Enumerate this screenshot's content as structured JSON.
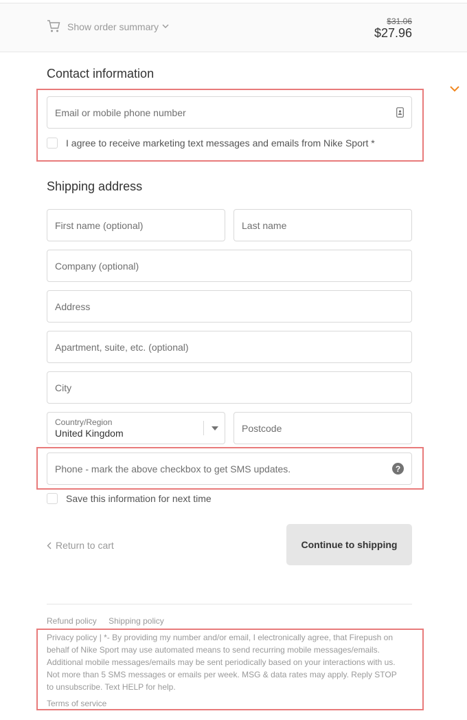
{
  "header": {
    "summary_toggle": "Show order summary",
    "original_price": "$31.06",
    "total_price": "$27.96"
  },
  "contact": {
    "title": "Contact information",
    "email_placeholder": "Email or mobile phone number",
    "marketing_label": "I agree to receive marketing text messages and emails from Nike Sport *",
    "marketing_checked": false
  },
  "shipping": {
    "title": "Shipping address",
    "first_name_placeholder": "First name (optional)",
    "last_name_placeholder": "Last name",
    "company_placeholder": "Company (optional)",
    "address_placeholder": "Address",
    "apartment_placeholder": "Apartment, suite, etc. (optional)",
    "city_placeholder": "City",
    "country_label": "Country/Region",
    "country_value": "United Kingdom",
    "postcode_placeholder": "Postcode",
    "phone_placeholder": "Phone - mark the above checkbox to get SMS updates.",
    "save_info_label": "Save this information for next time",
    "save_info_checked": false
  },
  "actions": {
    "return_label": "Return to cart",
    "continue_label": "Continue to shipping"
  },
  "footer": {
    "refund_policy": "Refund policy",
    "shipping_policy": "Shipping policy",
    "privacy_text": "Privacy policy | *- By providing my number and/or email, I electronically agree, that Firepush on behalf of Nike Sport may use automated means to send recurring mobile messages/emails. Additional mobile messages/emails may be sent periodically based on your interactions with us. Not more than 5 SMS messages or emails per week. MSG & data rates may apply. Reply STOP to unsubscribe. Text HELP for help.",
    "terms_of_service": "Terms of service"
  },
  "icons": {
    "cart": "cart-icon",
    "summary_chevron": "chevron-down-icon",
    "side_chevron": "chevron-down-icon",
    "contact_card": "contact-card-icon",
    "select_arrow": "caret-down-icon",
    "help": "help-icon",
    "back_chevron": "chevron-left-icon"
  },
  "colors": {
    "accent_orange": "#f0861e",
    "highlight_red": "#e87a7a",
    "button_bg": "#e6e6e6"
  }
}
